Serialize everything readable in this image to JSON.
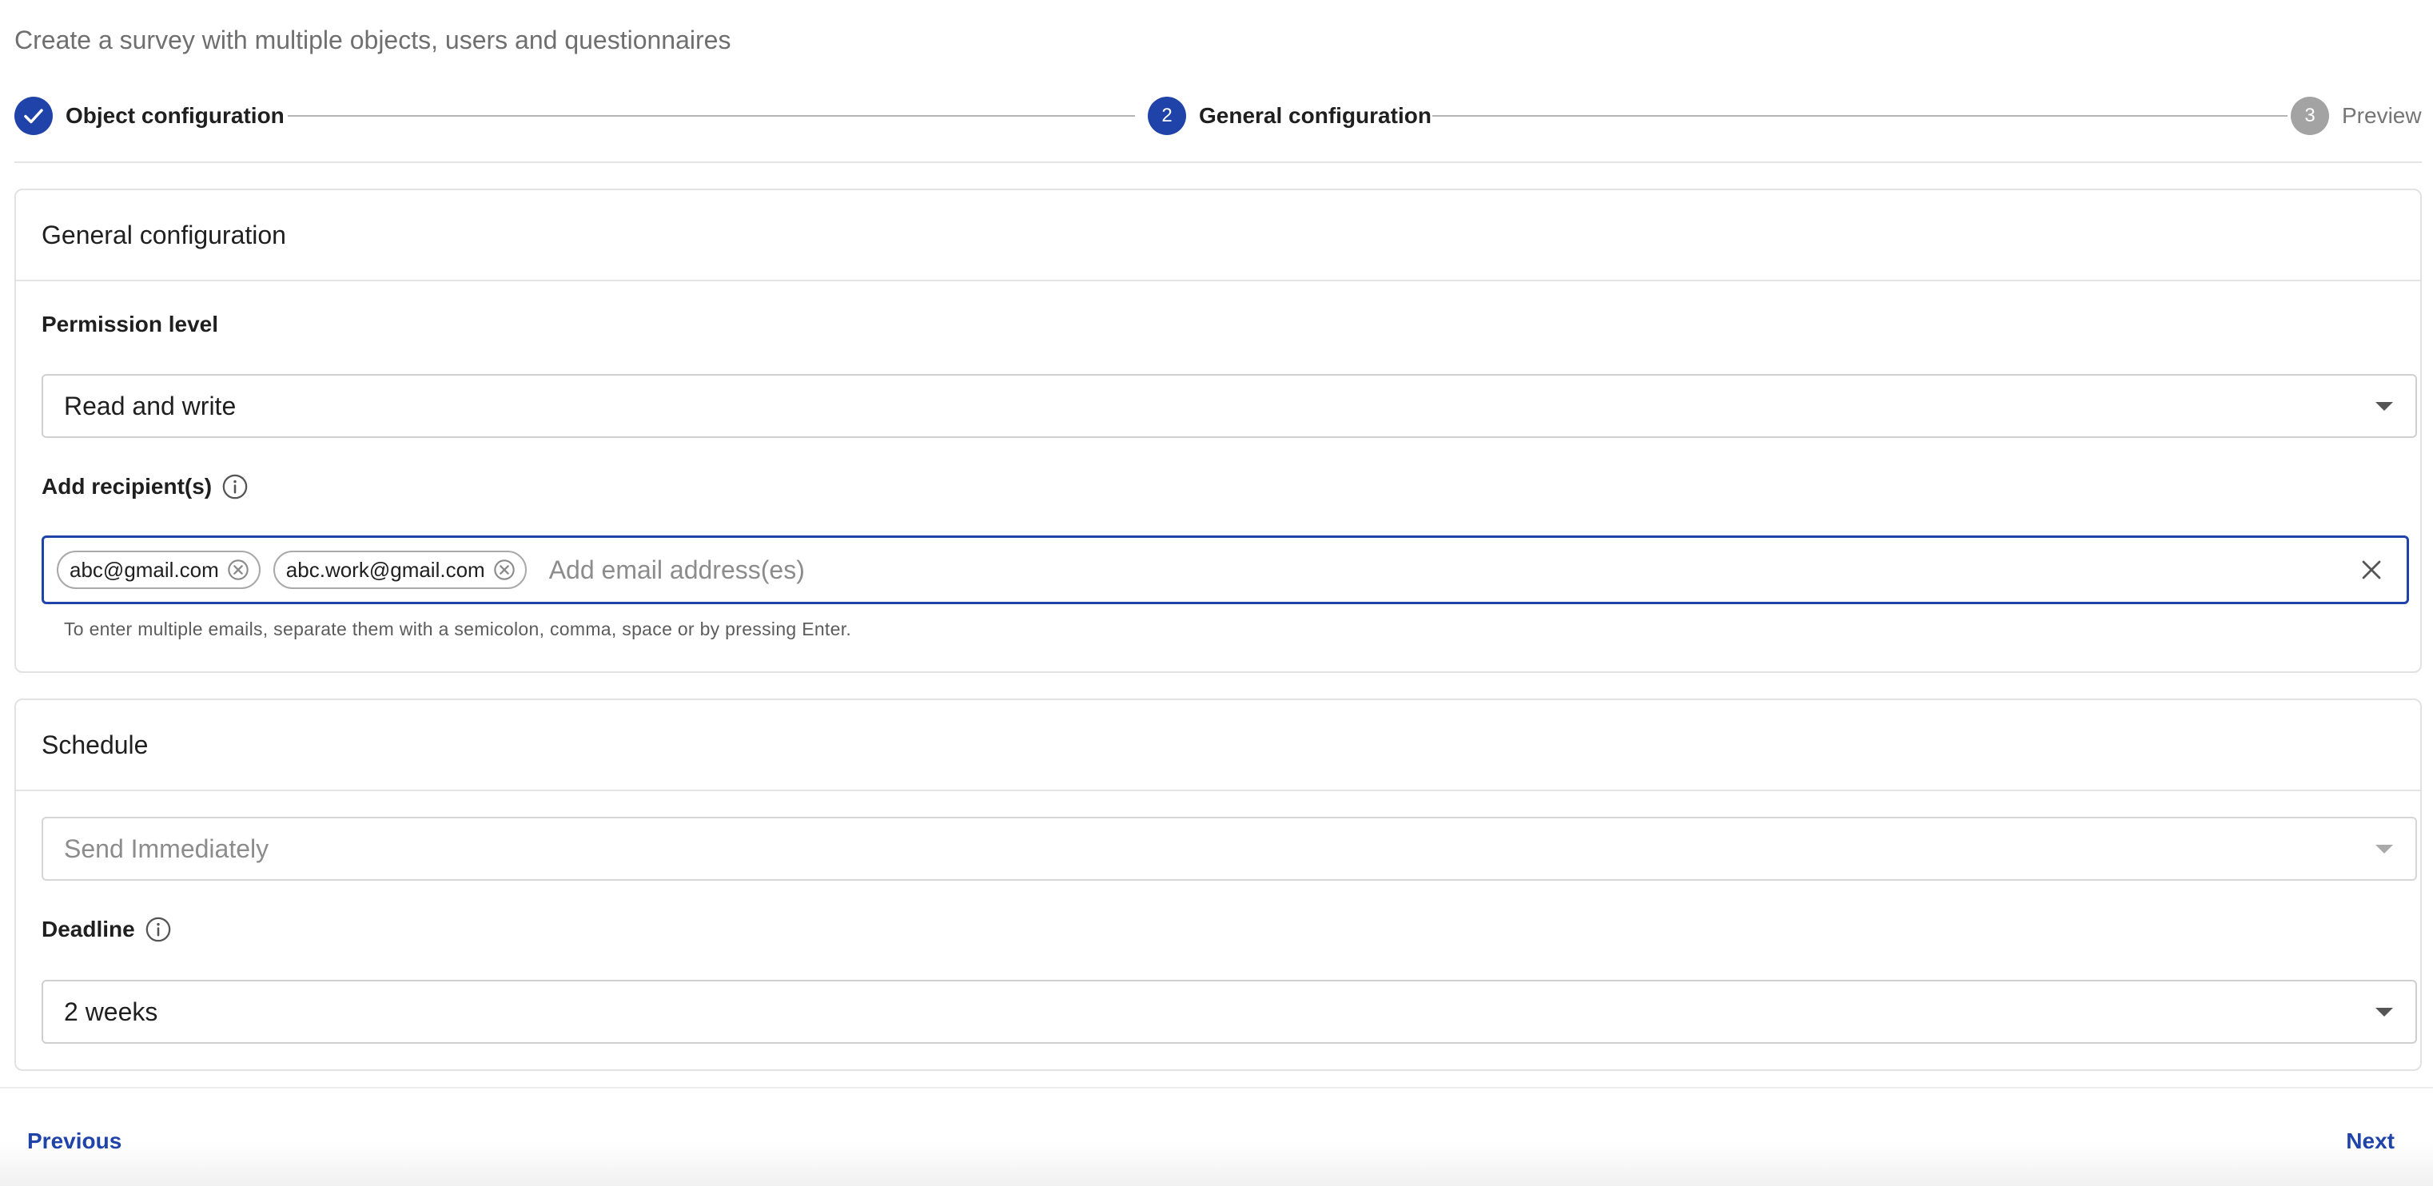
{
  "page": {
    "subtitle": "Create a survey with multiple objects, users and questionnaires"
  },
  "stepper": {
    "steps": [
      {
        "number": "1",
        "label": "Object configuration",
        "state": "completed"
      },
      {
        "number": "2",
        "label": "General configuration",
        "state": "active"
      },
      {
        "number": "3",
        "label": "Preview",
        "state": "upcoming"
      }
    ]
  },
  "general_config": {
    "title": "General configuration",
    "permission_label": "Permission level",
    "permission_value": "Read and write",
    "recipients_label": "Add recipient(s)",
    "recipients": [
      "abc@gmail.com",
      "abc.work@gmail.com"
    ],
    "email_placeholder": "Add email address(es)",
    "helper_text": "To enter multiple emails, separate them with a semicolon, comma, space or by pressing Enter."
  },
  "schedule": {
    "title": "Schedule",
    "send_value": "Send Immediately",
    "deadline_label": "Deadline",
    "deadline_value": "2 weeks"
  },
  "footer": {
    "previous_label": "Previous",
    "next_label": "Next"
  },
  "colors": {
    "primary": "#1f43a8",
    "step_inactive": "#a3a3a3",
    "border": "#e2e2e2"
  },
  "icons": {
    "step1": "checkmark-icon",
    "info": "info-icon",
    "chip_remove": "close-circle-icon",
    "clear": "close-icon",
    "dropdown": "chevron-down-icon"
  }
}
